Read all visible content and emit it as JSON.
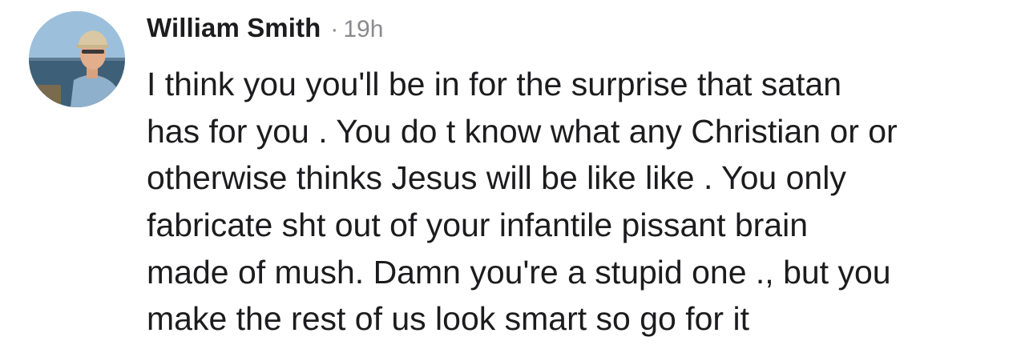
{
  "comment": {
    "author": "William Smith",
    "separator": "·",
    "time": "19h",
    "lines": [
      "I think you you'll be in for the surprise that satan",
      "has for you . You do t know what any Christian or or",
      "otherwise thinks Jesus will be like like . You only",
      "fabricate sht out of your infantile pissant brain",
      "made of mush. Damn you're a stupid one ., but you",
      "make the rest of us look smart so go for it"
    ]
  },
  "colors": {
    "text": "#1c1c1e",
    "meta": "#8a8a8e",
    "background": "#ffffff"
  },
  "icons": {
    "avatar": "profile-photo"
  }
}
